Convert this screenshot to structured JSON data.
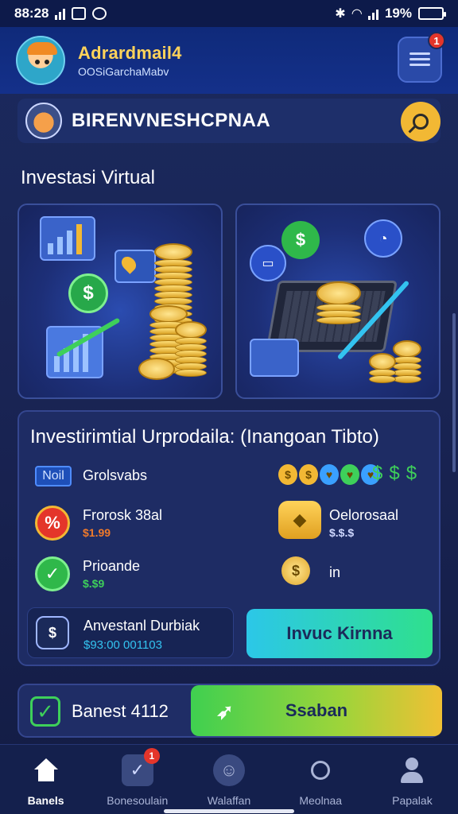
{
  "status_bar": {
    "time": "88:28",
    "battery": "19%",
    "battery_level": 0.19
  },
  "header": {
    "title": "Adrardmail4",
    "subtitle": "OOSiGarchaMabv",
    "notification_count": "1"
  },
  "shop": {
    "name": "BIRENVNESHCPNAA"
  },
  "section_title": "Investasi Virtual",
  "invest_panel": {
    "title": "Investirimtial Urprodaila: (Inangoan Tibto)",
    "tag": "Noil",
    "row1_label": "Grolsvabs",
    "row2_label": "Frorosk 38al",
    "row2_value": "$1.99",
    "row3_label": "Prioande",
    "row3_value": "$.$9",
    "row4_label": "Oelorosaal",
    "row4_value": "$.$.$",
    "row5_label": "in",
    "sub_card_title": "Anvestanl Durbiak",
    "sub_card_value": "$93:00 001103",
    "invest_button": "Invuc Kirnna"
  },
  "action_bar": {
    "label": "Banest 4112",
    "button": "Ssaban"
  },
  "nav": [
    {
      "label": "Banels"
    },
    {
      "label": "Bonesoulain",
      "badge": "1"
    },
    {
      "label": "Walaffan"
    },
    {
      "label": "Meolnaa"
    },
    {
      "label": "Papalak"
    }
  ],
  "colors": {
    "accent_gold": "#f2b834",
    "accent_green": "#3ed05a",
    "badge_red": "#e4352a",
    "panel_blue": "#1e2c64"
  }
}
